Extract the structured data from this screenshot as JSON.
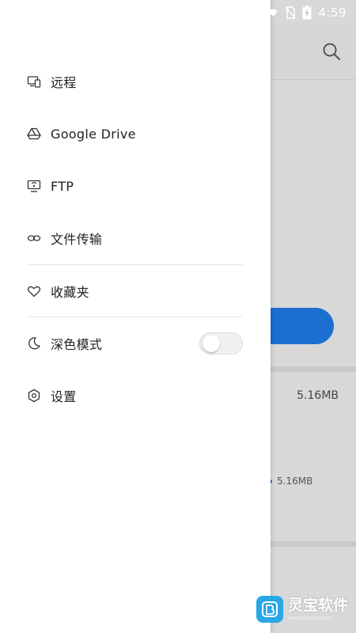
{
  "status_bar": {
    "time": "4:59",
    "icons": [
      "wifi-icon",
      "no-sim-icon",
      "battery-charging-icon"
    ]
  },
  "drawer": {
    "items": [
      {
        "label": "远程",
        "icon": "remote-device-icon"
      },
      {
        "label": "Google Drive",
        "icon": "google-drive-icon"
      },
      {
        "label": "FTP",
        "icon": "ftp-monitor-icon"
      },
      {
        "label": "文件传输",
        "icon": "link-infinity-icon"
      },
      {
        "label": "收藏夹",
        "icon": "heart-icon"
      },
      {
        "label": "深色模式",
        "icon": "moon-icon"
      },
      {
        "label": "设置",
        "icon": "settings-hex-icon"
      }
    ],
    "dark_mode_enabled": false
  },
  "background": {
    "storage_size_1": "5.16MB",
    "storage_size_2": "5.16MB",
    "accent": "#1c6fd0"
  },
  "watermark": {
    "title": "灵宝软件",
    "url": "www.lbwtw.com"
  }
}
